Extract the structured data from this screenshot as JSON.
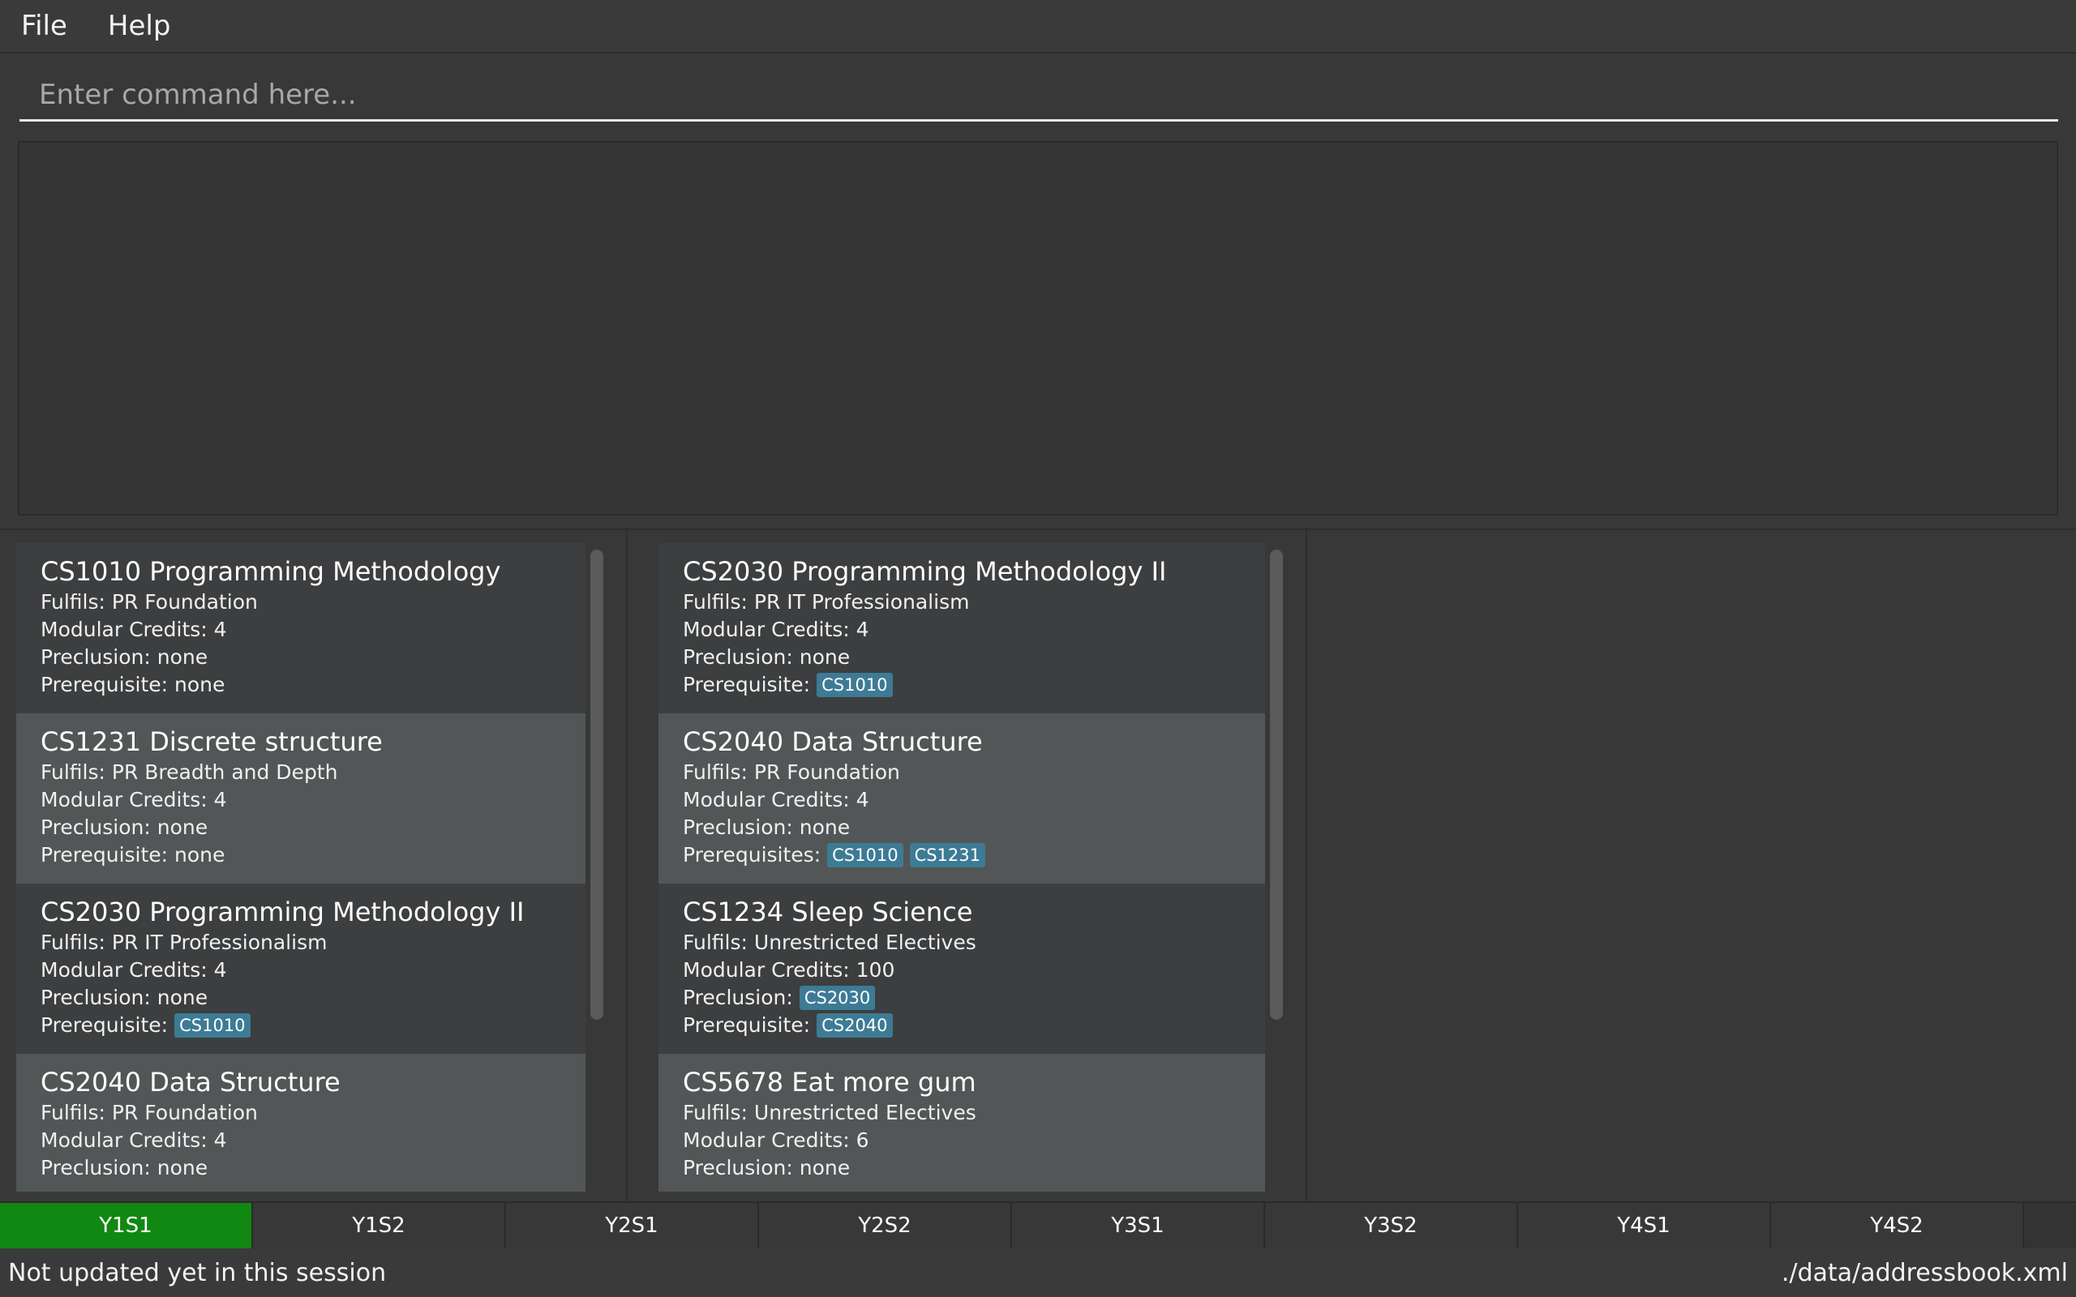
{
  "menu": {
    "file": "File",
    "help": "Help"
  },
  "command": {
    "placeholder": "Enter command here...",
    "value": ""
  },
  "labels": {
    "fulfils": "Fulfils:",
    "credits": "Modular Credits:",
    "preclusion": "Preclusion:",
    "prerequisite": "Prerequisite:",
    "prerequisites": "Prerequisites:"
  },
  "left_list": [
    {
      "title": "CS1010 Programming Methodology",
      "fulfils": "Fulfils: PR Foundation",
      "credits": "Modular Credits: 4",
      "preclusion": "Preclusion: none",
      "prereq_label": "Prerequisite: none",
      "prereq_tags": []
    },
    {
      "title": "CS1231 Discrete structure",
      "fulfils": "Fulfils: PR Breadth and Depth",
      "credits": "Modular Credits: 4",
      "preclusion": "Preclusion: none",
      "prereq_label": "Prerequisite: none",
      "prereq_tags": []
    },
    {
      "title": "CS2030 Programming Methodology II",
      "fulfils": "Fulfils: PR IT Professionalism",
      "credits": "Modular Credits: 4",
      "preclusion": "Preclusion: none",
      "prereq_label": "Prerequisite:",
      "prereq_tags": [
        "CS1010"
      ]
    },
    {
      "title": "CS2040 Data Structure",
      "fulfils": "Fulfils: PR Foundation",
      "credits": "Modular Credits: 4",
      "preclusion": "Preclusion: none",
      "prereq_label": "",
      "prereq_tags": []
    }
  ],
  "right_list": [
    {
      "title": "CS2030 Programming Methodology II",
      "fulfils": "Fulfils: PR IT Professionalism",
      "credits": "Modular Credits: 4",
      "preclusion": "Preclusion: none",
      "prereq_label": "Prerequisite:",
      "prereq_tags": [
        "CS1010"
      ]
    },
    {
      "title": "CS2040 Data Structure",
      "fulfils": "Fulfils: PR Foundation",
      "credits": "Modular Credits: 4",
      "preclusion": "Preclusion: none",
      "prereq_label": "Prerequisites:",
      "prereq_tags": [
        "CS1010",
        "CS1231"
      ]
    },
    {
      "title": "CS1234 Sleep Science",
      "fulfils": "Fulfils: Unrestricted Electives",
      "credits": "Modular Credits: 100",
      "preclusion_label": "Preclusion:",
      "preclusion_tags": [
        "CS2030"
      ],
      "prereq_label": "Prerequisite:",
      "prereq_tags": [
        "CS2040"
      ]
    },
    {
      "title": "CS5678 Eat more gum",
      "fulfils": "Fulfils: Unrestricted Electives",
      "credits": "Modular Credits: 6",
      "preclusion": "Preclusion: none",
      "prereq_label": "",
      "prereq_tags": []
    }
  ],
  "tabs": [
    "Y1S1",
    "Y1S2",
    "Y2S1",
    "Y2S2",
    "Y3S1",
    "Y3S2",
    "Y4S1",
    "Y4S2"
  ],
  "active_tab": "Y1S1",
  "status": {
    "left": "Not updated yet in this session",
    "right": "./data/addressbook.xml"
  },
  "colors": {
    "active_tab": "#118811",
    "tag": "#3d7b95",
    "background": "#383838"
  }
}
